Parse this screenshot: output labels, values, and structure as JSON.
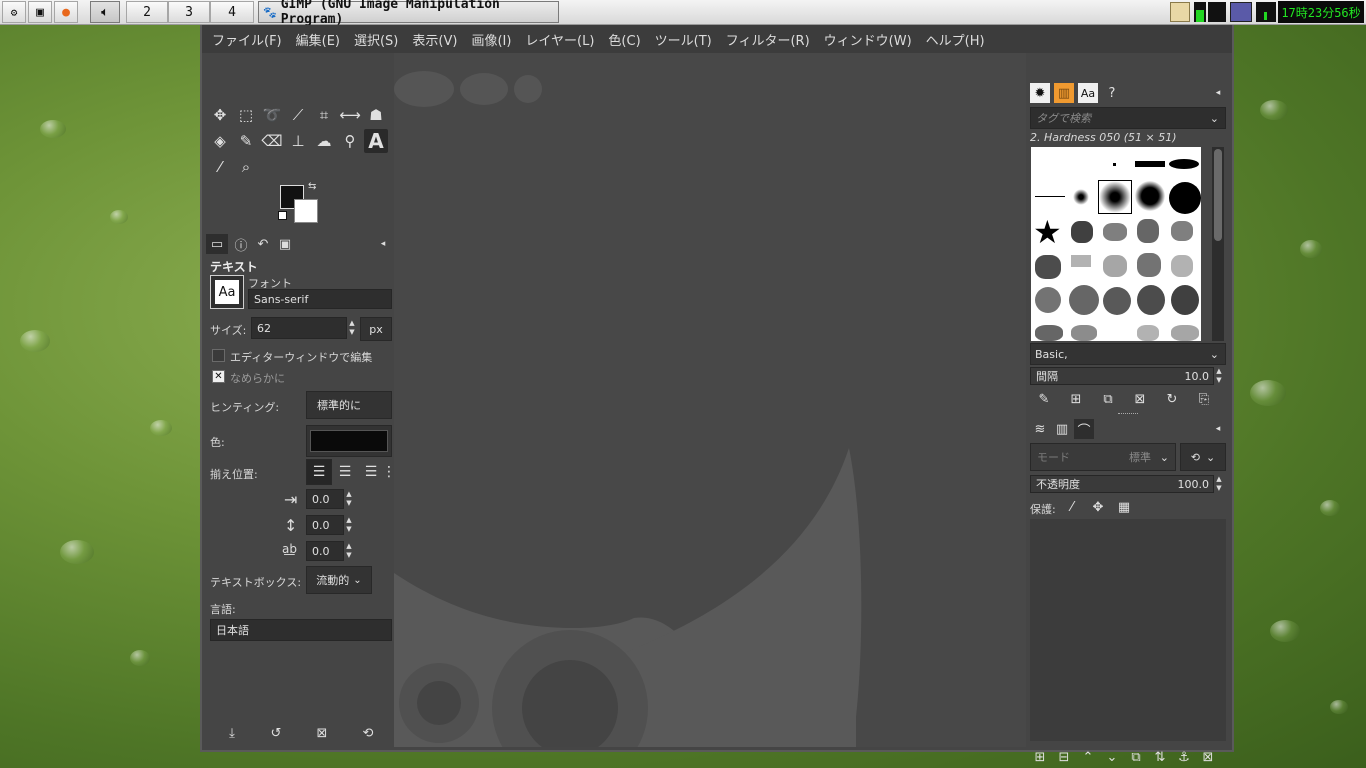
{
  "top_panel": {
    "workspaces": [
      "2",
      "3",
      "4"
    ],
    "task_title": "GIMP (GNU Image Manipulation Program)",
    "clock": "17時23分56秒"
  },
  "gimp": {
    "menu": [
      "ファイル(F)",
      "編集(E)",
      "選択(S)",
      "表示(V)",
      "画像(I)",
      "レイヤー(L)",
      "色(C)",
      "ツール(T)",
      "フィルター(R)",
      "ウィンドウ(W)",
      "ヘルプ(H)"
    ],
    "tool_options": {
      "title": "テキスト",
      "font_label": "フォント",
      "font_preview": "Aa",
      "font_value": "Sans-serif",
      "size_label": "サイズ:",
      "size_value": "62",
      "size_unit": "px",
      "use_editor_label": "エディターウィンドウで編集",
      "antialias_label": "なめらかに",
      "antialias_checked": true,
      "hinting_label": "ヒンティング:",
      "hinting_value": "標準的に",
      "color_label": "色:",
      "color_value": "#0a0a0a",
      "justify_label": "揃え位置:",
      "indent_value": "0.0",
      "line_spacing_value": "0.0",
      "letter_spacing_value": "0.0",
      "textbox_label": "テキストボックス:",
      "textbox_value": "流動的",
      "language_label": "言語:",
      "language_value": "日本語"
    },
    "brushes": {
      "tag_placeholder": "タグで検索",
      "selected": "2. Hardness 050 (51 × 51)",
      "preset_value": "Basic,",
      "spacing_label": "間隔",
      "spacing_value": "10.0"
    },
    "layers": {
      "mode_label": "モード",
      "mode_value": "標準",
      "opacity_label": "不透明度",
      "opacity_value": "100.0",
      "lock_label": "保護:"
    },
    "colors": {
      "window_bg": "#454545",
      "menubar_bg": "#3c3c3c",
      "canvas_bg": "#484848",
      "wilber": "#595959",
      "clock_fg": "#22e622"
    }
  }
}
